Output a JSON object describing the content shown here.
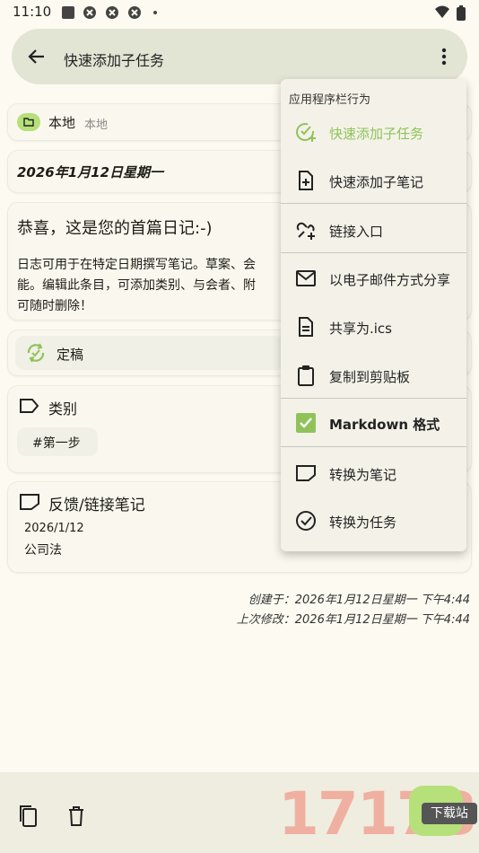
{
  "status": {
    "time": "11:10"
  },
  "topbar": {
    "title": "快速添加子任务"
  },
  "collection": {
    "name": "本地",
    "sub": "本地"
  },
  "date": {
    "label": "2026年1月12日星期一"
  },
  "journal": {
    "title": "恭喜，这是您的首篇日记:-)",
    "body_l1": "日志可用于在特定日期撰写笔记。草案、会",
    "body_l2": "能。编辑此条目，可添加类别、与会者、附",
    "body_l3": "可随时删除！"
  },
  "status_card": {
    "label": "定稿"
  },
  "categories": {
    "title": "类别",
    "chip": "#第一步"
  },
  "feedback": {
    "title": "反馈/链接笔记",
    "date": "2026/1/12",
    "text": "公司法"
  },
  "meta": {
    "created": "创建于：2026年1月12日星期一 下午4:44",
    "modified": "上次修改：2026年1月12日星期一 下午4:44"
  },
  "menu": {
    "header": "应用程序栏行为",
    "items": [
      {
        "label": "快速添加子任务",
        "icon": "add-task-icon"
      },
      {
        "label": "快速添加子笔记",
        "icon": "add-note-icon"
      },
      {
        "label": "链接入口",
        "icon": "add-link-icon"
      },
      {
        "label": "以电子邮件方式分享",
        "icon": "mail-icon"
      },
      {
        "label": "共享为.ics",
        "icon": "file-icon"
      },
      {
        "label": "复制到剪贴板",
        "icon": "clipboard-icon"
      },
      {
        "label": "Markdown 格式",
        "icon": "checkbox-icon"
      },
      {
        "label": "转换为笔记",
        "icon": "note-icon"
      },
      {
        "label": "转换为任务",
        "icon": "task-icon"
      }
    ]
  },
  "colors": {
    "accent": "#8fc35a",
    "background": "#fdfbf1",
    "topbar": "#e2e4d4",
    "menu": "#f4f2e8"
  },
  "watermark": {
    "text": "17178",
    "badge": "下载站"
  }
}
